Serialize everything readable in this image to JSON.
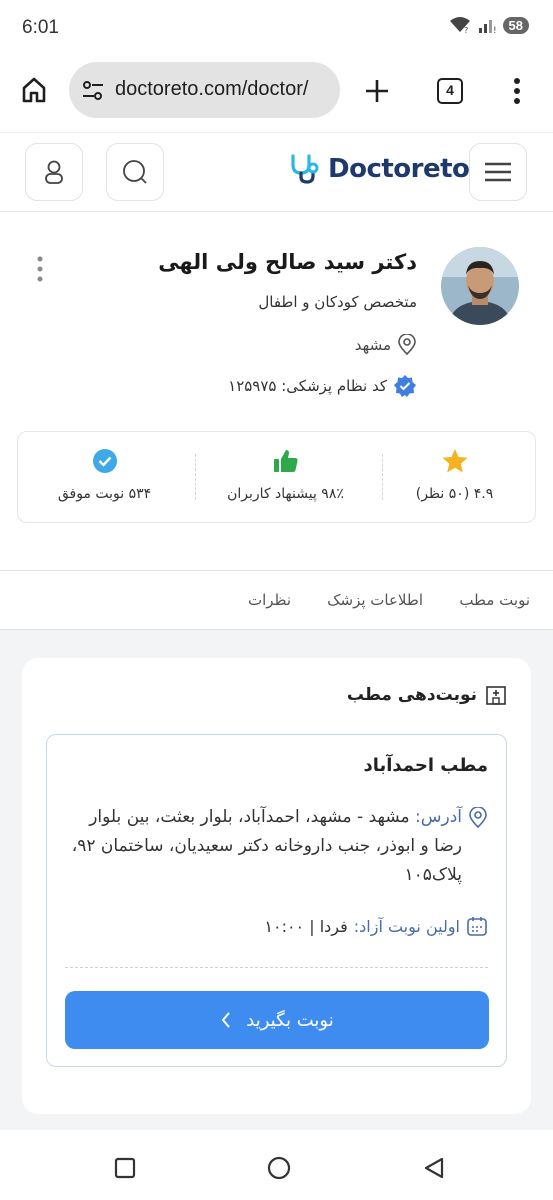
{
  "status_bar": {
    "time": "6:01",
    "battery": "58"
  },
  "browser": {
    "url": "doctoreto.com/doctor/",
    "tab_count": "4"
  },
  "site": {
    "logo_text": "Doctoreto"
  },
  "doctor": {
    "name": "دکتر سید صالح ولی الهی",
    "specialty": "متخصص کودکان و اطفال",
    "city": "مشهد",
    "medical_code": "کد نظام پزشکی: ۱۲۵۹۷۵"
  },
  "stats": {
    "rating": "۴.۹ (۵۰ نظر)",
    "recommend": "۹۸٪ پیشنهاد کاربران",
    "appointments": "۵۳۴ نوبت موفق"
  },
  "tabs": [
    "نوبت مطب",
    "اطلاعات پزشک",
    "نظرات"
  ],
  "booking": {
    "section_title": "نوبت‌دهی مطب",
    "office_name": "مطب احمدآباد",
    "address_label": "آدرس:",
    "address": "مشهد - مشهد، احمدآباد، بلوار بعثت، بین بلوار رضا و ابوذر، جنب داروخانه دکتر سعیدیان، ساختمان ۹۲، پلاک۱۰۵",
    "first_label": "اولین نوبت آزاد:",
    "first_value": "فردا | ۱۰:۰۰",
    "button": "نوبت بگیرید"
  },
  "colors": {
    "brand": "#1e3a6d",
    "accent": "#3f8cf1",
    "star": "#f5b323",
    "thumb": "#2ea84a",
    "check": "#3fa9e8"
  }
}
